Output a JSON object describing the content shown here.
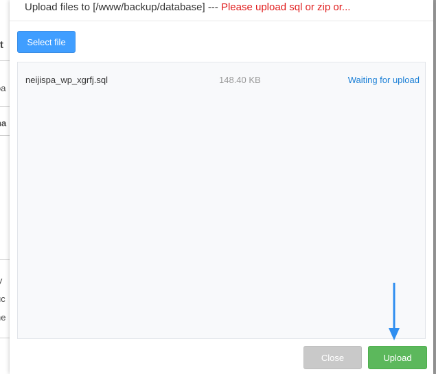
{
  "background": {
    "fragments": [
      "rt",
      "oa",
      "na",
      "ly",
      "uc",
      "he"
    ]
  },
  "dialog": {
    "title_prefix": "Upload files to [/www/backup/database] --- ",
    "title_warning": "Please upload sql or zip or...",
    "select_button": "Select file",
    "files": [
      {
        "name": "neijispa_wp_xgrfj.sql",
        "size": "148.40 KB",
        "status": "Waiting for upload"
      }
    ],
    "close_button": "Close",
    "upload_button": "Upload"
  },
  "colors": {
    "warning": "#e01b1b",
    "primary": "#409eff",
    "status_link": "#1a7fd6",
    "upload_green": "#5cb85c",
    "close_gray": "#c9c9c9",
    "arrow": "#2f8ef0"
  },
  "icons": {
    "annotation": "down-arrow-icon"
  }
}
